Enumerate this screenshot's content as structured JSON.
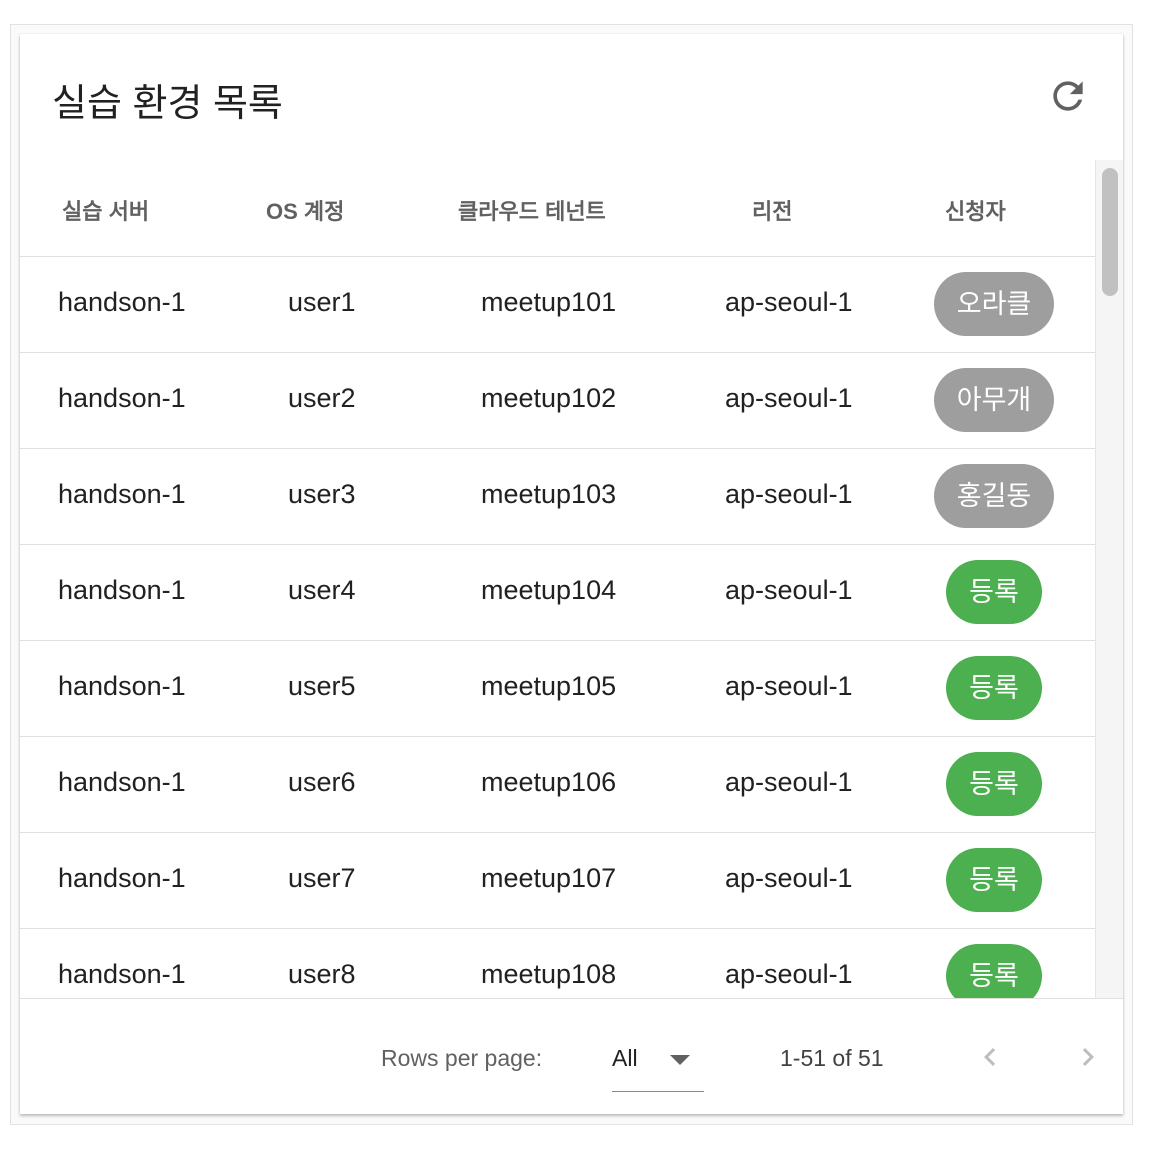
{
  "card": {
    "title": "실습 환경 목록"
  },
  "table": {
    "headers": [
      "실습 서버",
      "OS 계정",
      "클라우드 테넌트",
      "리전",
      "신청자"
    ],
    "rows": [
      {
        "server": "handson-1",
        "account": "user1",
        "tenant": "meetup101",
        "region": "ap-seoul-1",
        "applicant": "오라클",
        "status": "taken"
      },
      {
        "server": "handson-1",
        "account": "user2",
        "tenant": "meetup102",
        "region": "ap-seoul-1",
        "applicant": "아무개",
        "status": "taken"
      },
      {
        "server": "handson-1",
        "account": "user3",
        "tenant": "meetup103",
        "region": "ap-seoul-1",
        "applicant": "홍길동",
        "status": "taken"
      },
      {
        "server": "handson-1",
        "account": "user4",
        "tenant": "meetup104",
        "region": "ap-seoul-1",
        "applicant": "등록",
        "status": "available"
      },
      {
        "server": "handson-1",
        "account": "user5",
        "tenant": "meetup105",
        "region": "ap-seoul-1",
        "applicant": "등록",
        "status": "available"
      },
      {
        "server": "handson-1",
        "account": "user6",
        "tenant": "meetup106",
        "region": "ap-seoul-1",
        "applicant": "등록",
        "status": "available"
      },
      {
        "server": "handson-1",
        "account": "user7",
        "tenant": "meetup107",
        "region": "ap-seoul-1",
        "applicant": "등록",
        "status": "available"
      },
      {
        "server": "handson-1",
        "account": "user8",
        "tenant": "meetup108",
        "region": "ap-seoul-1",
        "applicant": "등록",
        "status": "available"
      }
    ]
  },
  "footer": {
    "rows_per_page_label": "Rows per page:",
    "rows_per_page_value": "All",
    "range_text": "1-51 of 51"
  },
  "icons": {
    "refresh": "refresh-icon",
    "prev": "chevron-left-icon",
    "next": "chevron-right-icon",
    "dropdown": "arrow-drop-down-icon"
  },
  "colors": {
    "taken_chip": "#9e9e9e",
    "register_chip": "#4caf50"
  }
}
